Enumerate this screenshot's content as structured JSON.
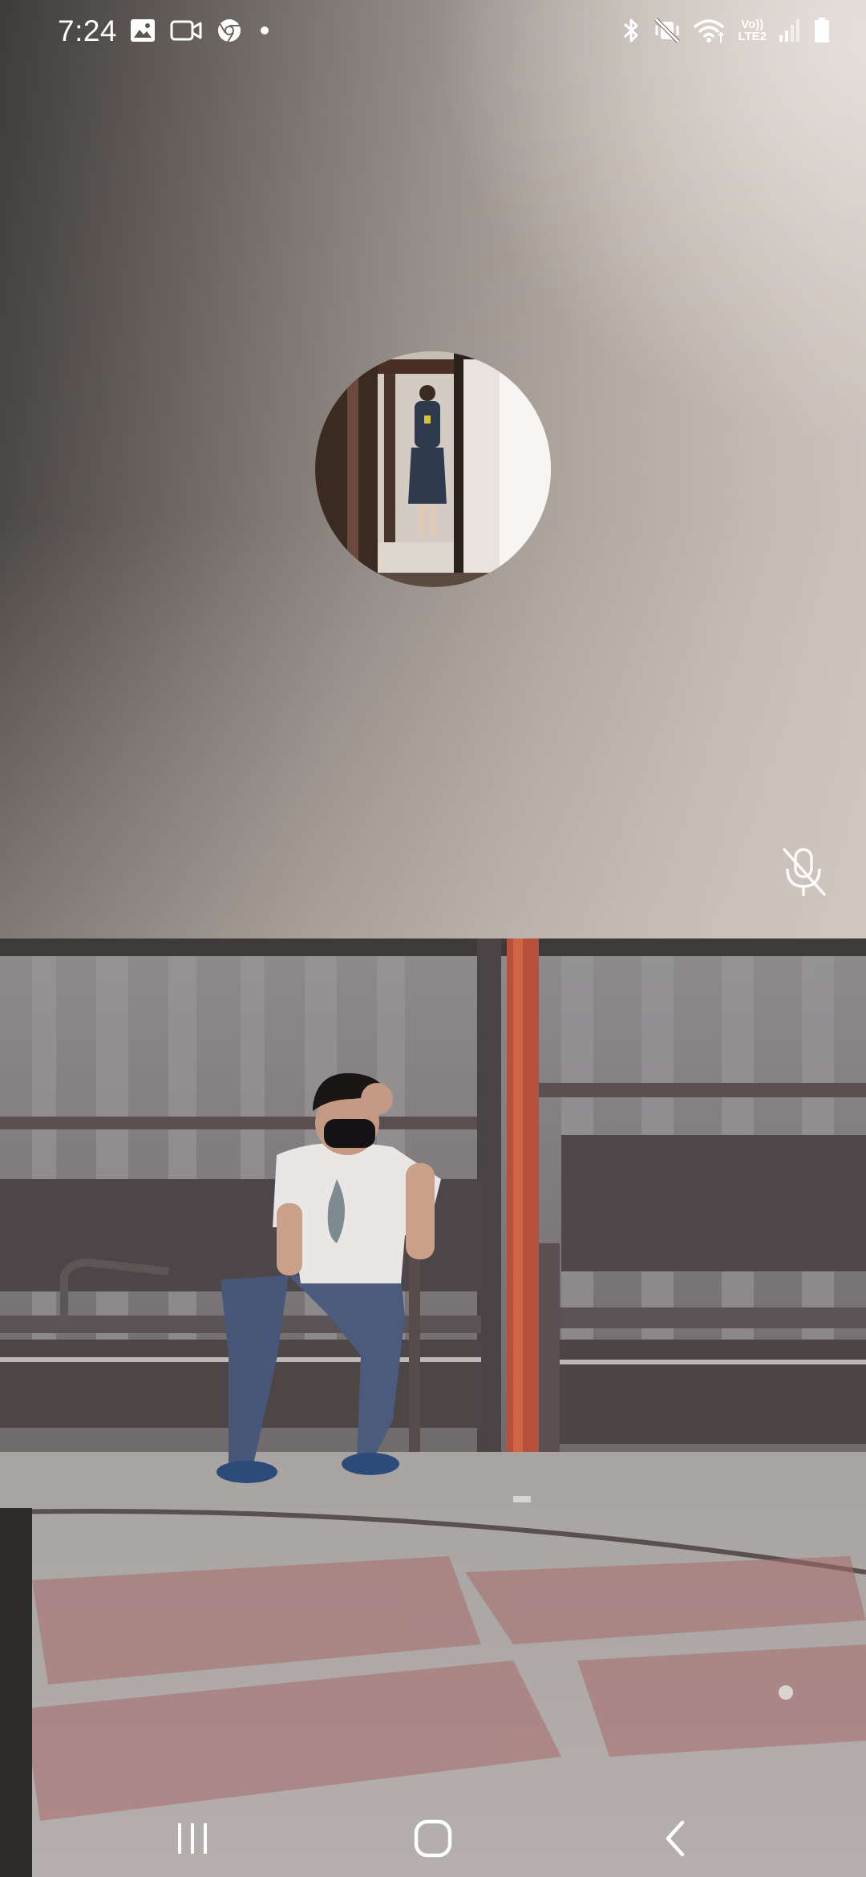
{
  "status_bar": {
    "time": "7:24",
    "network_label_line1": "Vo))",
    "network_label_line2": "LTE2",
    "left_icons": [
      "gallery-icon",
      "video-camera-icon",
      "chrome-icon",
      "dot-icon"
    ],
    "right_icons": [
      "bluetooth-icon",
      "vibrate-icon",
      "wifi-icon",
      "signal-icon",
      "battery-icon"
    ]
  },
  "call": {
    "remote_muted": true,
    "remote_avatar": "participant-photo",
    "self_view": "camera-preview"
  },
  "nav_bar": {
    "buttons": [
      "recent-apps",
      "home",
      "back"
    ]
  }
}
